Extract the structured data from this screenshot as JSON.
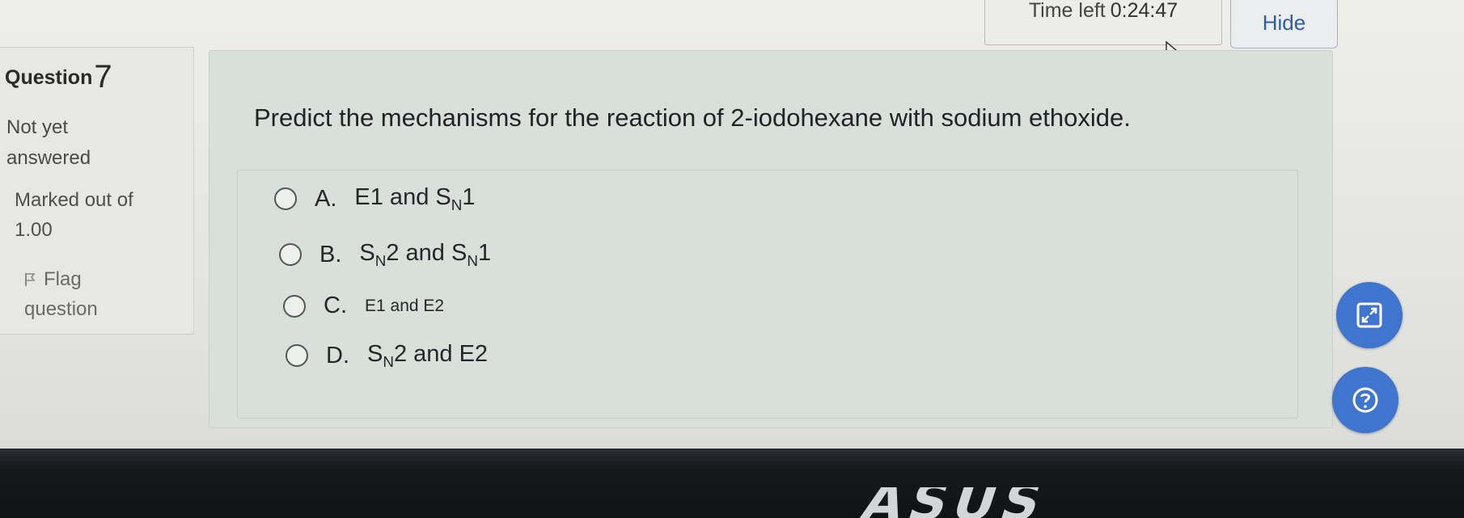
{
  "timer": {
    "label": "Time left",
    "value": "0:24:47"
  },
  "hide_button": {
    "label": "Hide"
  },
  "question_info": {
    "heading": "Question",
    "number": "7",
    "status_line1": "Not yet",
    "status_line2": "answered",
    "marked_line1": "Marked out of",
    "marked_line2": "1.00",
    "flag_line1": "Flag",
    "flag_line2": "question"
  },
  "question": {
    "prompt": "Predict the mechanisms for the reaction of 2-iodohexane with sodium ethoxide.",
    "options": [
      {
        "letter": "A.",
        "text": "E1 and SN1"
      },
      {
        "letter": "B.",
        "text": "SN2 and SN1"
      },
      {
        "letter": "C.",
        "text": "E1 and E2"
      },
      {
        "letter": "D.",
        "text": "SN2 and E2"
      }
    ]
  },
  "brand": {
    "logo_text": "ASUS"
  },
  "colors": {
    "accent": "#3f74cf",
    "link": "#2c5da9"
  },
  "icons": [
    "expand-icon",
    "help-icon",
    "flag-icon",
    "mouse-cursor-icon"
  ]
}
